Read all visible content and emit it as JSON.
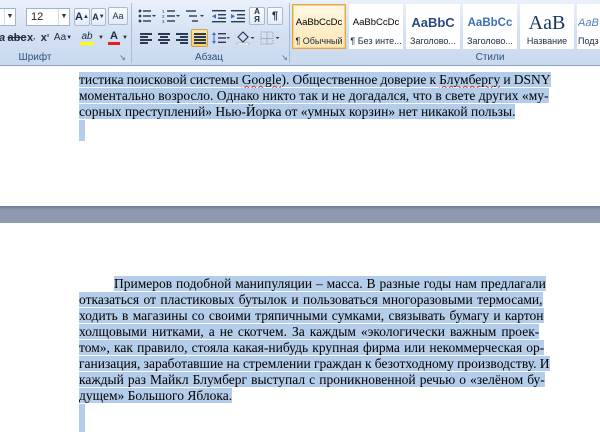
{
  "ribbon": {
    "font_group": {
      "label": "Шрифт",
      "size_value": "12",
      "grow_label": "A",
      "shrink_label": "A",
      "clear_label": "Aa",
      "subscript_label": "x",
      "superscript_label": "x",
      "case_label": "Aa",
      "highlight_label": "ab",
      "font_color_label": "A",
      "partial_left_label": "a"
    },
    "paragraph_group": {
      "label": "Абзац",
      "pilcrow_label": "¶"
    },
    "styles_group": {
      "label": "Стили",
      "tiles": [
        {
          "preview": "AaBbCcDc",
          "name": "¶ Обычный"
        },
        {
          "preview": "AaBbCcDc",
          "name": "¶ Без инте..."
        },
        {
          "preview": "AaBbC",
          "name": "Заголово..."
        },
        {
          "preview": "AaBbCc",
          "name": "Заголово..."
        },
        {
          "preview": "AaB",
          "name": "Название"
        },
        {
          "preview": "AaBbC",
          "name": "Подзаг"
        }
      ]
    }
  },
  "document": {
    "page1": {
      "lines": [
        {
          "pre": "тистика поисковой системы ",
          "word": "Google",
          "post": "). Общественное доверие к ",
          "word2": "Блумбергу",
          "post2": " и DSNY"
        },
        {
          "text": "моментально возросло. Однако никто так и не догадался, что в свете других «му-"
        },
        {
          "text": "сорных преступлений» Нью-Йорка от «умных корзин» нет никакой пользы."
        }
      ]
    },
    "page2": {
      "lines": [
        "Примеров подобной манипуляции – масса. В разные годы нам предлагали",
        "отказаться от пластиковых бутылок и пользоваться многоразовыми термосами,",
        "ходить в магазины со своими тряпичными сумками, связывать бумагу и картон",
        "холщовыми нитками, а не скотчем. За каждым «экологически важным проек-",
        "том», как правило, стояла какая-нибудь крупная фирма или некоммерческая ор-",
        "ганизация, заработавшие на стремлении граждан к безотходному производству. И",
        "каждый раз Майкл Блумберг выступал с проникновенной речью о «зелёном бу-",
        "дущем» Большого Яблока."
      ]
    }
  },
  "colors": {
    "selection": "#b4cdea",
    "ribbon_bg": "#d3e0f2",
    "workspace": "#8e9ab0",
    "selected_style_border": "#e4a54a"
  }
}
